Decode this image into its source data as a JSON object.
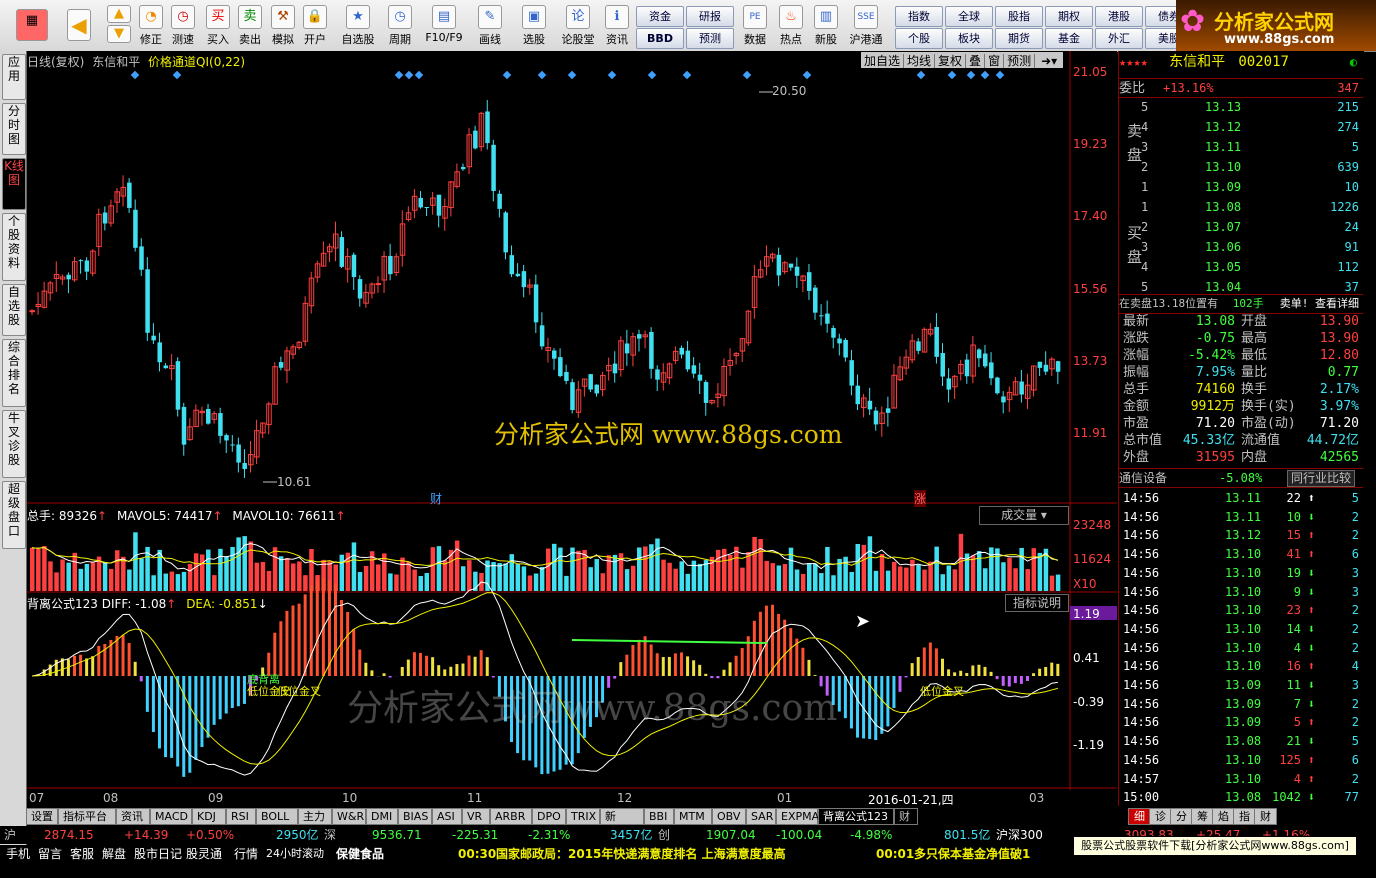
{
  "toolbar": {
    "buttons": [
      "修正",
      "测速",
      "买入",
      "卖出",
      "模拟",
      "开户",
      "自选股",
      "周期",
      "F10/F9",
      "画线",
      "选股",
      "论股堂",
      "资讯",
      "数据",
      "热点",
      "新股",
      "沪港通"
    ],
    "small_buttons": [
      "资金",
      "研报",
      "BBD",
      "预测",
      "指数",
      "全球",
      "股指",
      "期权",
      "港股",
      "债券",
      "个股",
      "板块",
      "期货",
      "基金",
      "外汇",
      "美股"
    ],
    "logo_text": "分析家公式网",
    "logo_url": "www.88gs.com"
  },
  "left_tabs": [
    "应用",
    "分时图",
    "K线图",
    "个股资料",
    "自选股",
    "综合排名",
    "牛叉诊股",
    "超级盘口"
  ],
  "chart": {
    "title_left": "日线(复权)",
    "stock_name": "东信和平",
    "indicator": "价格通道QI(0,22)",
    "top_buttons": [
      "加自选",
      "均线",
      "复权",
      "叠",
      "窗",
      "预测"
    ],
    "y_labels": [
      "21.05",
      "19.23",
      "17.40",
      "15.56",
      "13.73",
      "11.91"
    ],
    "high_label": "20.50",
    "low_label": "10.61",
    "marker_cai": "财",
    "marker_zhang": "涨",
    "vol_title": "总手: 89326",
    "mavol5": "MAVOL5: 74417",
    "mavol10": "MAVOL10: 76611",
    "vol_button": "成交量",
    "vol_y": [
      "23248",
      "11624",
      "X10"
    ],
    "ind_title": "背离公式123",
    "diff": "DIFF: -1.08",
    "dea": "DEA: -0.851",
    "ind_button": "指标说明",
    "ind_y": [
      "1.19",
      "0.41",
      "-0.39",
      "-1.19"
    ],
    "ind_labels": [
      "底背离",
      "低位金叉",
      "低位金叉",
      "低位金叉"
    ],
    "x_labels": [
      "07",
      "08",
      "09",
      "10",
      "11",
      "12",
      "01",
      "03"
    ],
    "date_label": "2016-01-21,四",
    "watermark": "分析家公式网 www.88gs.com",
    "watermark2": "分析家公式网www.88gs.com"
  },
  "chart_data": {
    "type": "candlestick",
    "title": "东信和平 日线(复权)",
    "ylim": [
      10.61,
      21.05
    ],
    "high": 20.5,
    "low": 10.61,
    "x_labels": [
      "07",
      "08",
      "09",
      "10",
      "11",
      "12",
      "01",
      "03"
    ]
  },
  "bottom_tabs": [
    "设置",
    "指标平台",
    "资讯",
    "MACD",
    "KDJ",
    "RSI",
    "BOLL",
    "主力",
    "W&R",
    "DMI",
    "BIAS",
    "ASI",
    "VR",
    "ARBR",
    "DPO",
    "TRIX",
    "新DMA",
    "BBI",
    "MTM",
    "OBV",
    "SAR",
    "EXPMA",
    "背离公式123",
    "财"
  ],
  "right": {
    "stock_name": "东信和平",
    "code": "002017",
    "weibi_label": "委比",
    "weibi_pct": "+13.16%",
    "weibi_val": "347",
    "sell": [
      [
        "5",
        "13.13",
        "215"
      ],
      [
        "4",
        "13.12",
        "274"
      ],
      [
        "3",
        "13.11",
        "5"
      ],
      [
        "2",
        "13.10",
        "639"
      ],
      [
        "1",
        "13.09",
        "10"
      ]
    ],
    "buy": [
      [
        "1",
        "13.08",
        "1226"
      ],
      [
        "2",
        "13.07",
        "24"
      ],
      [
        "3",
        "13.06",
        "91"
      ],
      [
        "4",
        "13.05",
        "112"
      ],
      [
        "5",
        "13.04",
        "37"
      ]
    ],
    "sell_label": "卖盘",
    "buy_label": "买盘",
    "zaimai": "在卖盘13.18位置有",
    "zaimai_val": "102手",
    "zaimai_link": "卖单! 查看详细",
    "stats": [
      [
        "最新",
        "13.08",
        "开盘",
        "13.90"
      ],
      [
        "涨跌",
        "-0.75",
        "最高",
        "13.90"
      ],
      [
        "涨幅",
        "-5.42%",
        "最低",
        "12.80"
      ],
      [
        "振幅",
        "7.95%",
        "量比",
        "0.77"
      ],
      [
        "总手",
        "74160",
        "换手",
        "2.17%"
      ],
      [
        "金额",
        "9912万",
        "换手(实)",
        "3.97%"
      ],
      [
        "市盈",
        "71.20",
        "市盈(动)",
        "71.20"
      ],
      [
        "总市值",
        "45.33亿",
        "流通值",
        "44.72亿"
      ],
      [
        "外盘",
        "31595",
        "内盘",
        "42565"
      ]
    ],
    "industry": "通信设备",
    "industry_pct": "-5.08%",
    "industry_link": "同行业比较",
    "ticks": [
      [
        "14:56",
        "13.11",
        "22",
        "5"
      ],
      [
        "14:56",
        "13.11",
        "10",
        "2"
      ],
      [
        "14:56",
        "13.12",
        "15",
        "2"
      ],
      [
        "14:56",
        "13.10",
        "41",
        "6"
      ],
      [
        "14:56",
        "13.10",
        "19",
        "3"
      ],
      [
        "14:56",
        "13.10",
        "9",
        "3"
      ],
      [
        "14:56",
        "13.10",
        "23",
        "2"
      ],
      [
        "14:56",
        "13.10",
        "14",
        "2"
      ],
      [
        "14:56",
        "13.10",
        "4",
        "2"
      ],
      [
        "14:56",
        "13.10",
        "16",
        "4"
      ],
      [
        "14:56",
        "13.09",
        "11",
        "3"
      ],
      [
        "14:56",
        "13.09",
        "7",
        "2"
      ],
      [
        "14:56",
        "13.09",
        "5",
        "2"
      ],
      [
        "14:56",
        "13.08",
        "21",
        "5"
      ],
      [
        "14:56",
        "13.10",
        "125",
        "6"
      ],
      [
        "14:57",
        "13.10",
        "4",
        "2"
      ],
      [
        "15:00",
        "13.08",
        "1042",
        "77"
      ]
    ],
    "tabs": [
      "细",
      "诊",
      "分",
      "筹",
      "焰",
      "指",
      "财"
    ]
  },
  "status": {
    "sh_label": "沪",
    "sh": "2874.15",
    "sh_chg": "+14.39",
    "sh_pct": "+0.50%",
    "sh_amt": "2950亿",
    "sz_label": "深",
    "sz": "9536.71",
    "sz_chg": "-225.31",
    "sz_pct": "-2.31%",
    "sz_amt": "3457亿",
    "cy_label": "创",
    "cy": "1907.04",
    "cy_chg": "-100.04",
    "cy_pct": "-4.98%",
    "hs_amt": "801.5亿",
    "hs_label": "沪深300",
    "hs": "3093.83",
    "hs_chg": "+25.47",
    "hs_pct": "+1.16%"
  },
  "bottom": {
    "items": [
      "手机",
      "留言",
      "客服",
      "解盘",
      "股市日记",
      "股灵通",
      "行情",
      "24小时滚动"
    ],
    "news1": "保健食品",
    "news2_time": "00:30",
    "news2": "国家邮政局：2015年快递满意度排名 上海满意度最高",
    "news3_time": "00:01",
    "news3": "多只保本基金净值破1",
    "ad": "股票公式股票软件下载[分析家公式网www.88gs.com]"
  }
}
